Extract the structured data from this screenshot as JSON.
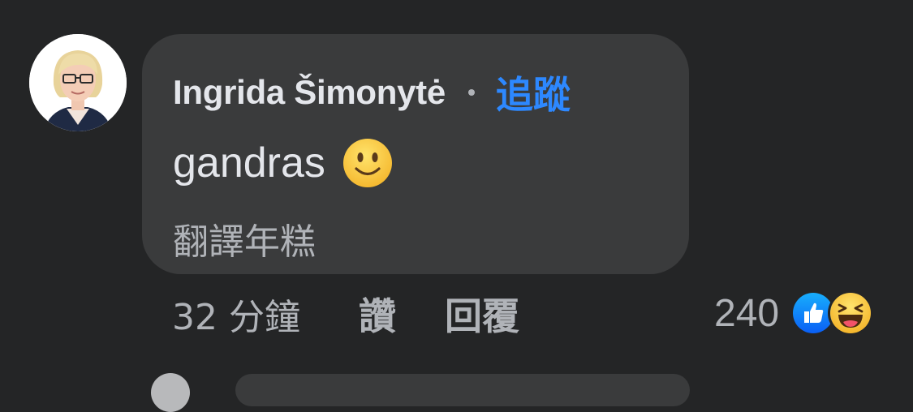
{
  "comment": {
    "author": "Ingrida Šimonytė",
    "follow_label": "追蹤",
    "text": "gandras",
    "translate_label": "翻譯年糕"
  },
  "actions": {
    "timestamp": "32 分鐘",
    "like_label": "讚",
    "reply_label": "回覆"
  },
  "reactions": {
    "count": "240",
    "types": [
      "like-icon",
      "haha-icon"
    ]
  },
  "icons": {
    "comment_emoji": "slightly-smiling-face-icon"
  },
  "colors": {
    "background": "#242526",
    "bubble": "#3a3b3c",
    "primary_text": "#e4e6eb",
    "secondary_text": "#b0b3b8",
    "link_blue": "#2d88ff",
    "like_blue": "#1877f2",
    "emoji_yellow": "#f7c94b"
  }
}
